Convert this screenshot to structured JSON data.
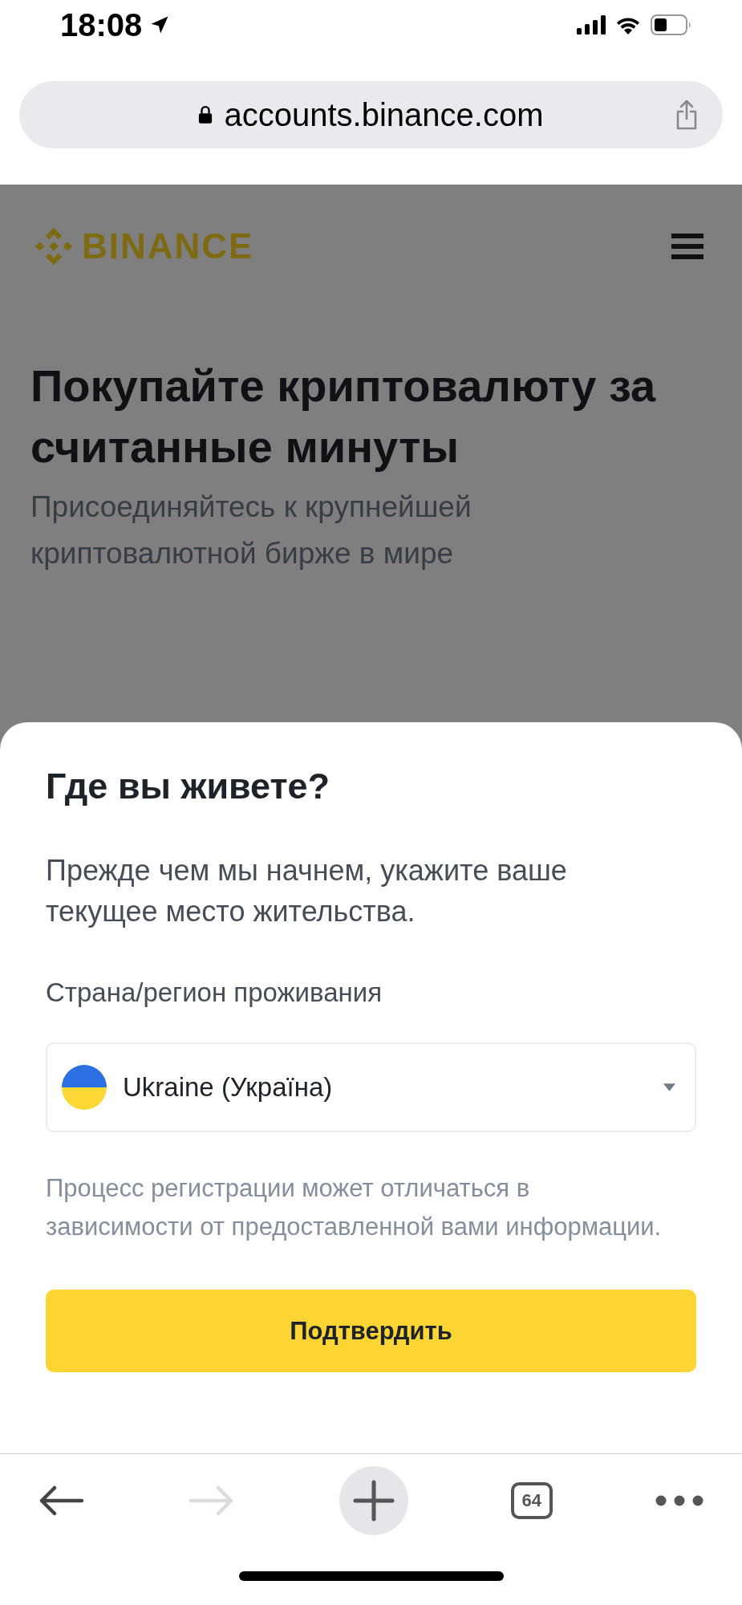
{
  "status_bar": {
    "time": "18:08"
  },
  "address_bar": {
    "url": "accounts.binance.com"
  },
  "page": {
    "logo": "BINANCE",
    "headline": "Покупайте криптовалюту за считанные минуты",
    "subtitle": "Присоединяйтесь к крупнейшей криптовалютной бирже в мире"
  },
  "dialog": {
    "title": "Где вы живете?",
    "description": "Прежде чем мы начнем, укажите ваше текущее место жительства.",
    "field_label": "Страна/регион проживания",
    "country": {
      "value": "Ukraine (Україна)"
    },
    "note": "Процесс регистрации может отличаться в зависимости от предоставленной вами информации.",
    "confirm_button": "Подтвердить"
  },
  "toolbar": {
    "items": [
      {
        "kind": "back",
        "disabled": false
      },
      {
        "kind": "forward",
        "disabled": true
      },
      {
        "kind": "new_tab",
        "disabled": false
      },
      {
        "kind": "tabs",
        "label": "64",
        "disabled": false
      },
      {
        "kind": "more",
        "disabled": false
      }
    ]
  }
}
